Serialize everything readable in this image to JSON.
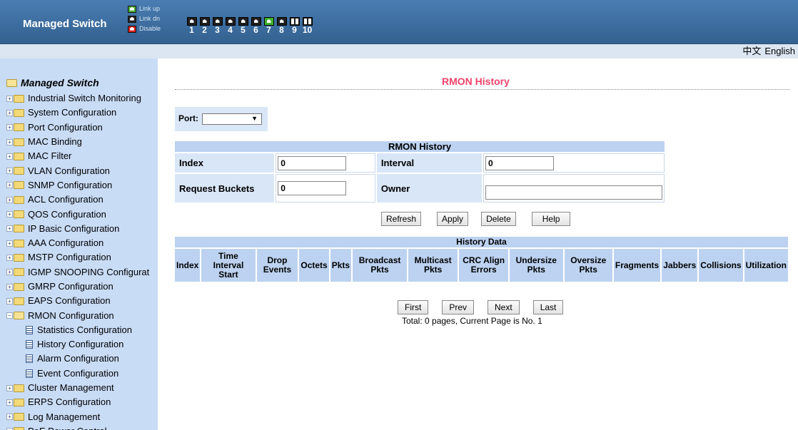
{
  "header": {
    "brand": "Managed Switch",
    "legend": {
      "up": "Link up",
      "dn": "Link dn",
      "disable": "Disable"
    },
    "ports": [
      {
        "num": "1",
        "state": "down"
      },
      {
        "num": "2",
        "state": "down"
      },
      {
        "num": "3",
        "state": "down"
      },
      {
        "num": "4",
        "state": "down"
      },
      {
        "num": "5",
        "state": "down"
      },
      {
        "num": "6",
        "state": "down"
      },
      {
        "num": "7",
        "state": "up"
      },
      {
        "num": "8",
        "state": "down"
      },
      {
        "num": "9",
        "state": "sfp"
      },
      {
        "num": "10",
        "state": "sfp"
      }
    ],
    "colors": {
      "link_up": "#3fb12a",
      "link_dn": "#1f1f1f",
      "disable": "#d91e1e",
      "header_bg": "#3f6fa3"
    }
  },
  "lang": {
    "chinese": "中文",
    "english": "English"
  },
  "sidebar": {
    "root": "Managed Switch",
    "items": [
      {
        "label": "Industrial Switch Monitoring",
        "type": "folder"
      },
      {
        "label": "System Configuration",
        "type": "folder"
      },
      {
        "label": "Port Configuration",
        "type": "folder"
      },
      {
        "label": "MAC Binding",
        "type": "folder"
      },
      {
        "label": "MAC Filter",
        "type": "folder"
      },
      {
        "label": "VLAN Configuration",
        "type": "folder"
      },
      {
        "label": "SNMP Configuration",
        "type": "folder"
      },
      {
        "label": "ACL Configuration",
        "type": "folder"
      },
      {
        "label": "QOS Configuration",
        "type": "folder"
      },
      {
        "label": "IP Basic Configuration",
        "type": "folder"
      },
      {
        "label": "AAA Configuration",
        "type": "folder"
      },
      {
        "label": "MSTP Configuration",
        "type": "folder"
      },
      {
        "label": "IGMP SNOOPING Configurat",
        "type": "folder"
      },
      {
        "label": "GMRP Configuration",
        "type": "folder"
      },
      {
        "label": "EAPS Configuration",
        "type": "folder"
      },
      {
        "label": "RMON Configuration",
        "type": "open"
      },
      {
        "label": "Statistics Configuration",
        "type": "doc"
      },
      {
        "label": "History Configuration",
        "type": "doc"
      },
      {
        "label": "Alarm Configuration",
        "type": "doc"
      },
      {
        "label": "Event Configuration",
        "type": "doc"
      },
      {
        "label": "Cluster Management",
        "type": "folder"
      },
      {
        "label": "ERPS Configuration",
        "type": "folder"
      },
      {
        "label": "Log Management",
        "type": "folder"
      },
      {
        "label": "PoE Power Control",
        "type": "folder"
      }
    ]
  },
  "main": {
    "title": "RMON History",
    "port_label": "Port:",
    "port_value": "",
    "history": {
      "caption": "RMON History",
      "index_label": "Index",
      "index_value": "0",
      "interval_label": "Interval",
      "interval_value": "0",
      "buckets_label": "Request Buckets",
      "buckets_value": "0",
      "owner_label": "Owner",
      "owner_value": ""
    },
    "buttons": {
      "refresh": "Refresh",
      "apply": "Apply",
      "delete": "Delete",
      "help": "Help"
    },
    "data": {
      "caption": "History Data",
      "columns": [
        "Index",
        "Time Interval Start",
        "Drop Events",
        "Octets",
        "Pkts",
        "Broadcast Pkts",
        "Multicast Pkts",
        "CRC Align Errors",
        "Undersize Pkts",
        "Oversize Pkts",
        "Fragments",
        "Jabbers",
        "Collisions",
        "Utilization"
      ]
    },
    "pager": {
      "first": "First",
      "prev": "Prev",
      "next": "Next",
      "last": "Last",
      "info": "Total: 0 pages, Current Page is No. 1"
    }
  }
}
